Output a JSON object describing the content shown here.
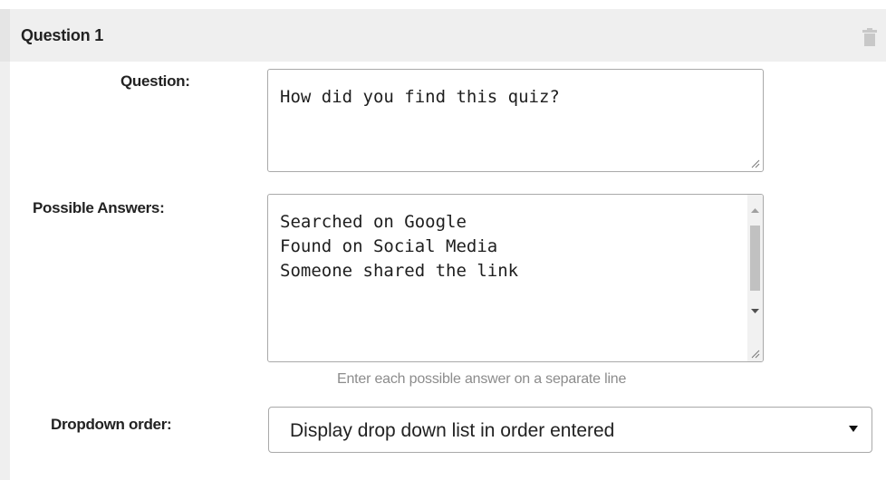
{
  "question_block": {
    "title": "Question 1"
  },
  "form": {
    "question_label": "Question:",
    "question_value": "How did you find this quiz?",
    "answers_label": "Possible Answers:",
    "answers_value": "Searched on Google\nFound on Social Media\nSomeone shared the link",
    "answers_hint": "Enter each possible answer on a separate line",
    "dropdown_label": "Dropdown order:",
    "dropdown_value": "Display drop down list in order entered"
  },
  "icons": {
    "delete": "trash-icon",
    "resize": "resize-grip-icon",
    "scroll_up": "scroll-up-arrow-icon",
    "scroll_down": "scroll-down-arrow-icon",
    "dropdown": "caret-down-icon"
  },
  "colors": {
    "header_bg": "#efefef",
    "text": "#222222",
    "hint": "#8c8c8c",
    "border": "#a9a9a9"
  }
}
